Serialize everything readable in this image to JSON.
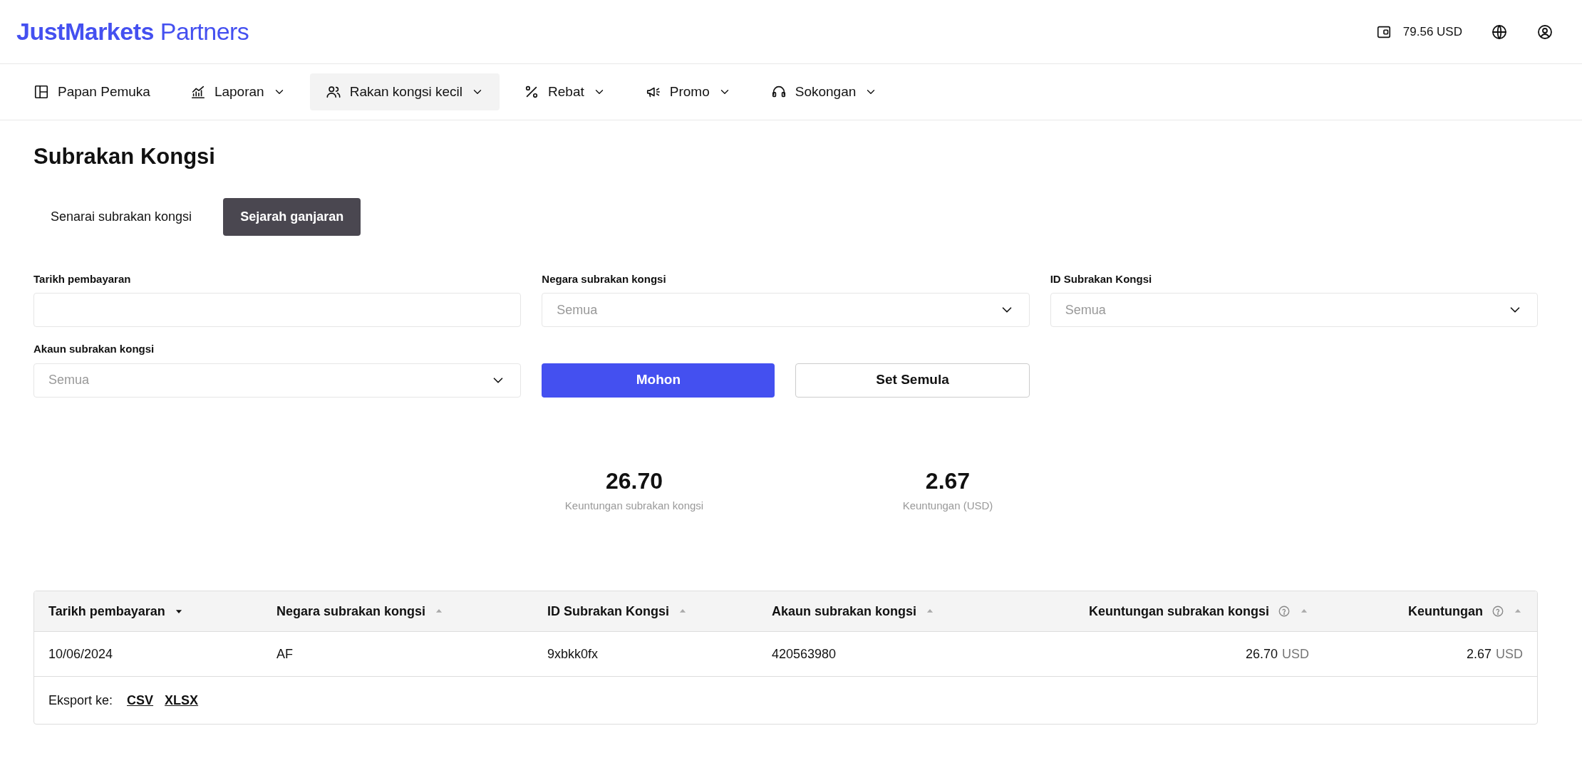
{
  "header": {
    "logo_brand": "JustMarkets",
    "logo_suffix": "Partners",
    "balance": "79.56 USD"
  },
  "nav": [
    {
      "label": "Papan Pemuka",
      "dropdown": false,
      "selected": false
    },
    {
      "label": "Laporan",
      "dropdown": true,
      "selected": false
    },
    {
      "label": "Rakan kongsi kecil",
      "dropdown": true,
      "selected": true
    },
    {
      "label": "Rebat",
      "dropdown": true,
      "selected": false
    },
    {
      "label": "Promo",
      "dropdown": true,
      "selected": false
    },
    {
      "label": "Sokongan",
      "dropdown": true,
      "selected": false
    }
  ],
  "page_title": "Subrakan Kongsi",
  "tabs": [
    {
      "label": "Senarai subrakan kongsi",
      "selected": false
    },
    {
      "label": "Sejarah ganjaran",
      "selected": true
    }
  ],
  "filters": [
    {
      "label": "Tarikh pembayaran",
      "kind": "date"
    },
    {
      "label": "Negara subrakan kongsi",
      "kind": "select",
      "placeholder": "Semua"
    },
    {
      "label": "ID Subrakan Kongsi",
      "kind": "select",
      "placeholder": "Semua"
    },
    {
      "label": "Akaun subrakan kongsi",
      "kind": "select",
      "placeholder": "Semua"
    }
  ],
  "buttons": [
    {
      "label": "Mohon",
      "kind": "primary"
    },
    {
      "label": "Set Semula",
      "kind": "outline"
    }
  ],
  "stats": [
    {
      "value": "26.70",
      "label": "Keuntungan subrakan kongsi"
    },
    {
      "value": "2.67",
      "label": "Keuntungan (USD)"
    }
  ],
  "table": {
    "columns": [
      {
        "label": "Tarikh pembayaran",
        "sorted": true,
        "help": false,
        "kind": "text"
      },
      {
        "label": "Negara subrakan kongsi",
        "sorted": false,
        "help": false,
        "kind": "text"
      },
      {
        "label": "ID Subrakan Kongsi",
        "sorted": false,
        "help": false,
        "kind": "text"
      },
      {
        "label": "Akaun subrakan kongsi",
        "sorted": false,
        "help": false,
        "kind": "text"
      },
      {
        "label": "Keuntungan subrakan kongsi",
        "sorted": false,
        "help": true,
        "kind": "money"
      },
      {
        "label": "Keuntungan",
        "sorted": false,
        "help": true,
        "kind": "money"
      }
    ],
    "rows": [
      [
        {
          "value": "10/06/2024"
        },
        {
          "value": "AF"
        },
        {
          "value": "9xbkk0fx"
        },
        {
          "value": "420563980"
        },
        {
          "value": "26.70",
          "currency": "USD"
        },
        {
          "value": "2.67",
          "currency": "USD"
        }
      ]
    ],
    "export_label": "Eksport ke:",
    "export_links": [
      "CSV",
      "XLSX"
    ]
  }
}
